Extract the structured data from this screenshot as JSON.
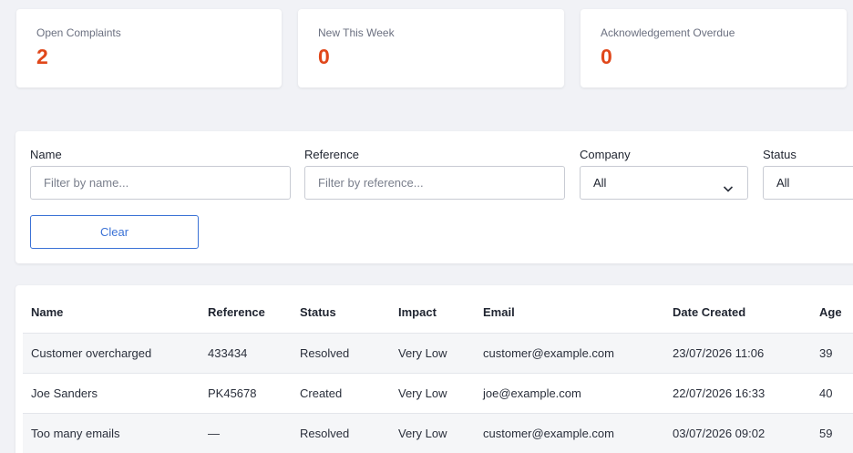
{
  "stats": [
    {
      "label": "Open Complaints",
      "value": "2"
    },
    {
      "label": "New This Week",
      "value": "0"
    },
    {
      "label": "Acknowledgement Overdue",
      "value": "0"
    }
  ],
  "colors": {
    "stat_value": "#e0471a",
    "accent": "#3b72d6",
    "background": "#f1f2f6"
  },
  "filters": {
    "name": {
      "label": "Name",
      "placeholder": "Filter by name..."
    },
    "reference": {
      "label": "Reference",
      "placeholder": "Filter by reference..."
    },
    "company": {
      "label": "Company",
      "value": "All",
      "icon": "chevron-down-icon"
    },
    "status": {
      "label": "Status",
      "value": "All"
    },
    "clear_label": "Clear"
  },
  "table": {
    "columns": [
      "Name",
      "Reference",
      "Status",
      "Impact",
      "Email",
      "Date Created",
      "Age"
    ],
    "rows": [
      [
        "Customer overcharged",
        "433434",
        "Resolved",
        "Very Low",
        "customer@example.com",
        "23/07/2026 11:06",
        "39"
      ],
      [
        "Joe Sanders",
        "PK45678",
        "Created",
        "Very Low",
        "joe@example.com",
        "22/07/2026 16:33",
        "40"
      ],
      [
        "Too many emails",
        "—",
        "Resolved",
        "Very Low",
        "customer@example.com",
        "03/07/2026 09:02",
        "59"
      ]
    ]
  }
}
